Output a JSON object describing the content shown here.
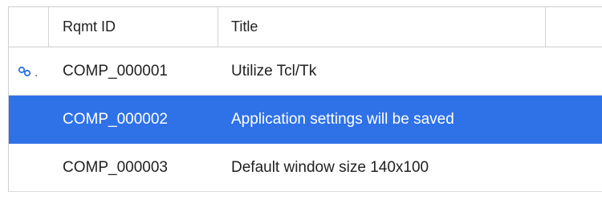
{
  "table": {
    "headers": {
      "id": "Rqmt ID",
      "title": "Title"
    },
    "rows": [
      {
        "id": "COMP_000001",
        "title": "Utilize Tcl/Tk",
        "has_link": true,
        "link_suffix": ".",
        "selected": false
      },
      {
        "id": "COMP_000002",
        "title": "Application settings will be saved",
        "has_link": false,
        "selected": true
      },
      {
        "id": "COMP_000003",
        "title": "Default window size 140x100",
        "has_link": false,
        "selected": false
      }
    ]
  },
  "colors": {
    "selection": "#2f72e8",
    "link_icon": "#2f72e8",
    "grid_line": "#dcdcdc"
  },
  "icons": {
    "link": "link-icon"
  }
}
